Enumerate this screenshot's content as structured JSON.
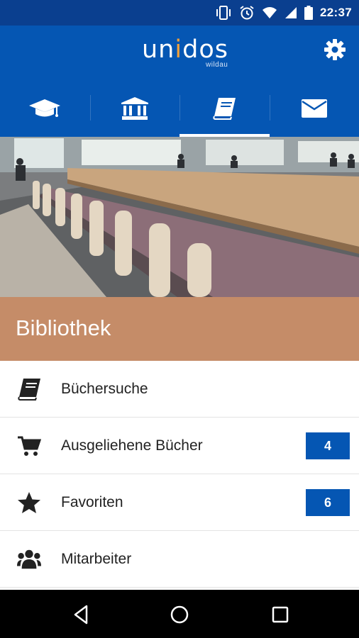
{
  "status_bar": {
    "time": "22:37"
  },
  "app": {
    "logo_text": "unidos",
    "logo_subtext": "wildau"
  },
  "tabs": [
    {
      "icon": "graduation-cap-icon",
      "active": false
    },
    {
      "icon": "bank-building-icon",
      "active": false
    },
    {
      "icon": "book-icon",
      "active": true
    },
    {
      "icon": "envelope-icon",
      "active": false
    }
  ],
  "section": {
    "title": "Bibliothek",
    "header_color": "#c58c68"
  },
  "menu": [
    {
      "label": "Büchersuche",
      "icon": "book-icon"
    },
    {
      "label": "Ausgeliehene Bücher",
      "icon": "cart-icon",
      "badge": "4"
    },
    {
      "label": "Favoriten",
      "icon": "star-icon",
      "badge": "6"
    },
    {
      "label": "Mitarbeiter",
      "icon": "users-icon"
    }
  ],
  "colors": {
    "primary": "#0556b3",
    "status_bar": "#0a3f8f",
    "accent": "#f3a13a"
  }
}
